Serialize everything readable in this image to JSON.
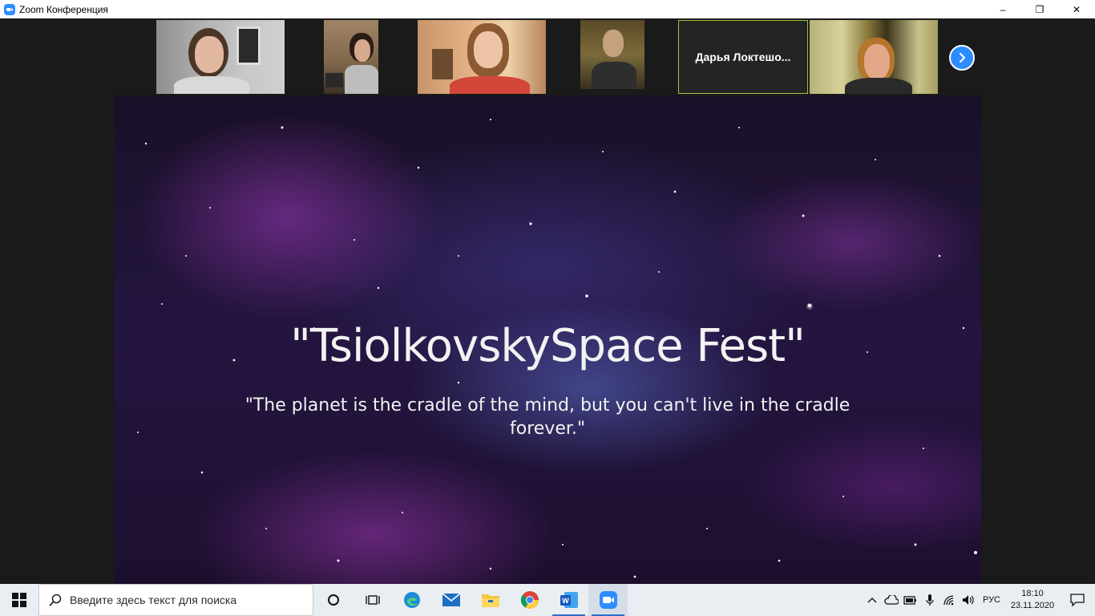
{
  "window": {
    "title": "Zoom Конференция",
    "icon": "zoom-camera-icon",
    "controls": {
      "minimize": "–",
      "restore": "❐",
      "close": "✕"
    }
  },
  "gallery": {
    "name_tile": "Дарья  Локтешо...",
    "next_icon": "chevron-right-icon",
    "accent": "#9bc53d"
  },
  "slide": {
    "title": "\"TsiolkovskySpace Fest\"",
    "quote": "\"The planet is the cradle of the mind, but you can't live in the cradle forever.\""
  },
  "taskbar": {
    "search_placeholder": "Введите здесь текст для поиска",
    "apps": [
      "task-view",
      "edge",
      "mail",
      "file-explorer",
      "chrome",
      "word",
      "zoom"
    ],
    "language": "РУС",
    "time": "18:10",
    "date": "23.11.2020"
  },
  "colors": {
    "zoom_blue": "#2d8cff",
    "taskbar_bg": "#e9eef3"
  }
}
